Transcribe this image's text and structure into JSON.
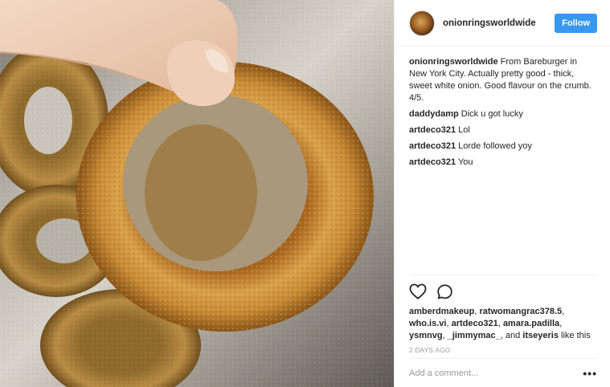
{
  "post": {
    "username": "onionringsworldwide",
    "follow_label": "Follow",
    "caption": {
      "user": "onionringsworldwide",
      "text": "From Bareburger in New York City. Actually pretty good - thick, sweet white onion. Good flavour on the crumb. 4/5."
    },
    "comments": [
      {
        "user": "daddydamp",
        "text": "Dick u got lucky"
      },
      {
        "user": "artdeco321",
        "text": "Lol"
      },
      {
        "user": "artdeco321",
        "text": "Lorde followed yoy"
      },
      {
        "user": "artdeco321",
        "text": "You"
      }
    ],
    "likes": {
      "users": [
        "amberdmakeup",
        "ratwomangrac378.5",
        "who.is.vi",
        "artdeco321",
        "amara.padilla",
        "ysmnvg",
        "_jimmymac_"
      ],
      "and_label": "and",
      "last_user": "itseyeris",
      "suffix": "like this"
    },
    "timestamp": "2 DAYS AGO",
    "add_comment_placeholder": "Add a comment...",
    "more_label": "•••",
    "icons": [
      "heart-icon",
      "comment-icon",
      "more-options-icon"
    ],
    "colors": {
      "follow_button": "#3897f0",
      "username": "#262626",
      "muted": "#999999"
    }
  }
}
